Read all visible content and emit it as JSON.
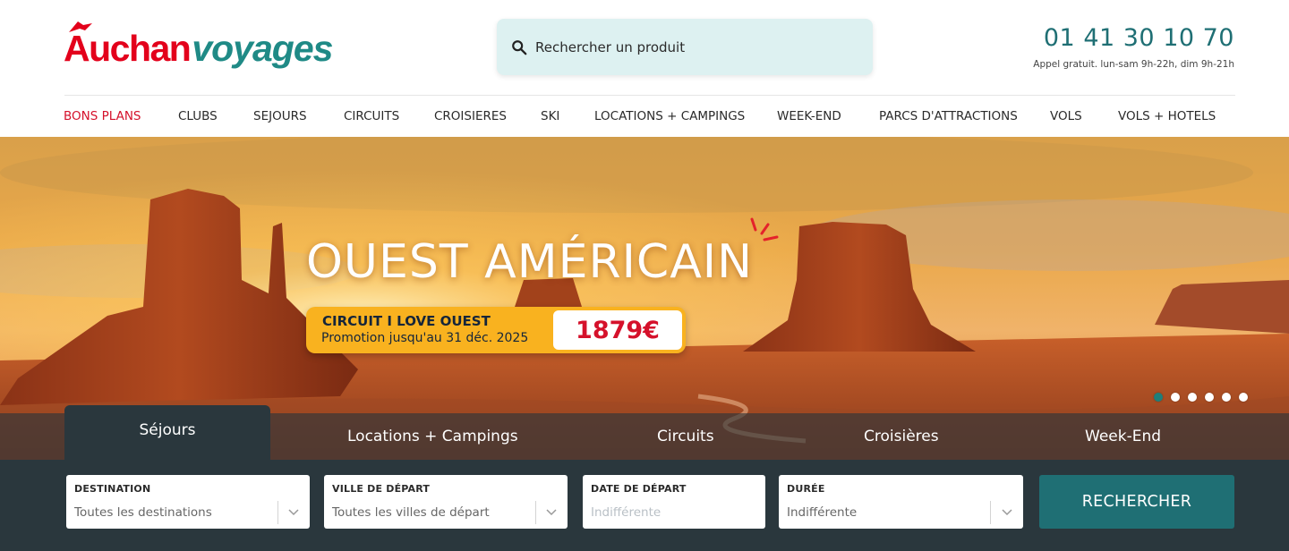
{
  "logo": {
    "part1": "Auchan",
    "part2": "voyages",
    "colors": {
      "red": "#e3001b",
      "teal": "#1f8a86"
    }
  },
  "search": {
    "placeholder": "Rechercher un produit",
    "icon": "search-icon"
  },
  "contact": {
    "phone": "01 41 30 10 70",
    "hours": "Appel gratuit. lun-sam 9h-22h, dim 9h-21h"
  },
  "nav": {
    "items": [
      {
        "label": "BONS PLANS",
        "highlight": true
      },
      {
        "label": "CLUBS"
      },
      {
        "label": "SEJOURS"
      },
      {
        "label": "CIRCUITS"
      },
      {
        "label": "CROISIERES"
      },
      {
        "label": "SKI"
      },
      {
        "label": "LOCATIONS + CAMPINGS"
      },
      {
        "label": "WEEK-END"
      },
      {
        "label": "PARCS D'ATTRACTIONS"
      },
      {
        "label": "VOLS"
      },
      {
        "label": "VOLS + HOTELS"
      }
    ]
  },
  "hero": {
    "title": "OUEST AMÉRICAIN",
    "promo_title": "CIRCUIT I LOVE OUEST",
    "promo_subtitle": "Promotion jusqu'au 31 déc. 2025",
    "price": "1879€",
    "slides_total": 6,
    "active_slide": 1
  },
  "tabs": [
    {
      "label": "Séjours",
      "active": true
    },
    {
      "label": "Locations + Campings"
    },
    {
      "label": "Circuits"
    },
    {
      "label": "Croisières"
    },
    {
      "label": "Week-End"
    }
  ],
  "form": {
    "destination": {
      "label": "DESTINATION",
      "value": "Toutes les destinations"
    },
    "departure_city": {
      "label": "VILLE DE DÉPART",
      "value": "Toutes les villes de départ"
    },
    "departure_date": {
      "label": "DATE DE DÉPART",
      "placeholder": "Indifférente"
    },
    "duration": {
      "label": "DURÉE",
      "value": "Indifférente"
    },
    "submit": "RECHERCHER"
  },
  "colors": {
    "accent": "#1f6f74",
    "highlight": "#d5112b",
    "promo": "#f9b21f",
    "dark": "#2a373d"
  }
}
